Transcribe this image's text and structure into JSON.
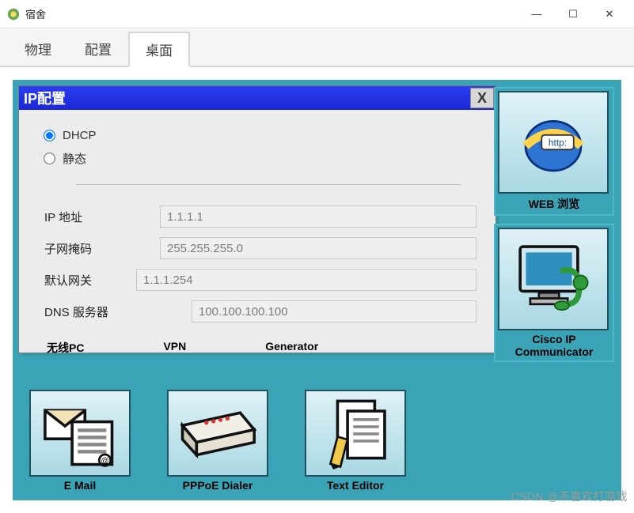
{
  "window": {
    "title": "宿舍",
    "minimize": "—",
    "maximize": "☐",
    "close": "✕"
  },
  "tabs": {
    "physical": "物理",
    "config": "配置",
    "desktop": "桌面"
  },
  "ip": {
    "title": "IP配置",
    "close": "X",
    "dhcp": "DHCP",
    "static": "静态",
    "ip_label": "IP 地址",
    "ip_value": "1.1.1.1",
    "mask_label": "子网掩码",
    "mask_value": "255.255.255.0",
    "gw_label": "默认网关",
    "gw_value": "1.1.1.254",
    "dns_label": "DNS 服务器",
    "dns_value": "100.100.100.100"
  },
  "apps": {
    "web": "WEB 浏览",
    "cisco_ip1": "Cisco IP",
    "cisco_ip2": "Communicator",
    "wireless": "无线PC",
    "vpn": "VPN",
    "generator": "Generator",
    "email": "E Mail",
    "pppoe": "PPPoE Dialer",
    "texteditor": "Text Editor",
    "http_badge": "http:"
  },
  "watermark": "CSDN @不喜欢打游戏"
}
